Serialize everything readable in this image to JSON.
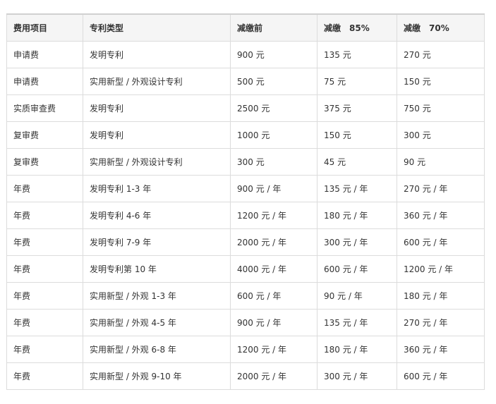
{
  "table": {
    "headers": [
      "费用项目",
      "专利类型",
      "减缴前",
      "减缴　85%",
      "减缴　70%"
    ],
    "rows": [
      [
        "申请费",
        "发明专利",
        "900 元",
        "135 元",
        "270 元"
      ],
      [
        "申请费",
        "实用新型 / 外观设计专利",
        "500 元",
        "75 元",
        "150 元"
      ],
      [
        "实质审查费",
        "发明专利",
        "2500 元",
        "375 元",
        "750 元"
      ],
      [
        "复审费",
        "发明专利",
        "1000 元",
        "150 元",
        "300 元"
      ],
      [
        "复审费",
        "实用新型 / 外观设计专利",
        "300 元",
        "45 元",
        "90 元"
      ],
      [
        "年费",
        "发明专利 1-3 年",
        "900 元 / 年",
        "135 元 / 年",
        "270 元 / 年"
      ],
      [
        "年费",
        "发明专利 4-6 年",
        "1200 元 / 年",
        "180 元 / 年",
        "360 元 / 年"
      ],
      [
        "年费",
        "发明专利 7-9 年",
        "2000 元 / 年",
        "300 元 / 年",
        "600 元 / 年"
      ],
      [
        "年费",
        "发明专利第 10 年",
        "4000 元 / 年",
        "600 元 / 年",
        "1200 元 / 年"
      ],
      [
        "年费",
        "实用新型 / 外观 1-3 年",
        "600 元 / 年",
        "90 元 / 年",
        "180 元 / 年"
      ],
      [
        "年费",
        "实用新型 / 外观 4-5 年",
        "900 元 / 年",
        "135 元 / 年",
        "270 元 / 年"
      ],
      [
        "年费",
        "实用新型 / 外观 6-8 年",
        "1200 元 / 年",
        "180 元 / 年",
        "360 元 / 年"
      ],
      [
        "年费",
        "实用新型 / 外观 9-10 年",
        "2000 元 / 年",
        "300 元 / 年",
        "600 元 / 年"
      ]
    ]
  }
}
